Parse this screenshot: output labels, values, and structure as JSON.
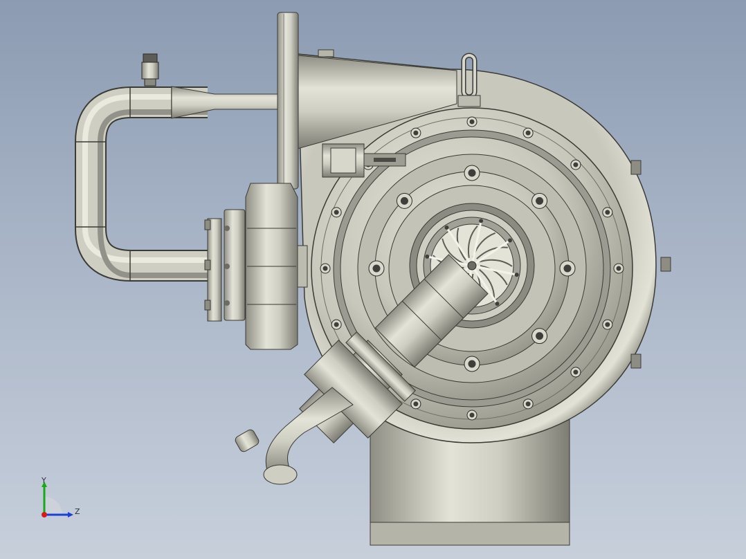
{
  "viewport": {
    "background_top": "#8c9bb2",
    "background_bottom": "#c7cfdb"
  },
  "model": {
    "body_color": "#c9c8bc",
    "shadow_color": "#8e8d83",
    "edge_color": "#3a3a36",
    "impeller_blades": 13
  },
  "triad": {
    "y_label": "Y",
    "z_label": "Z",
    "y_color": "#1aa81a",
    "z_color": "#1c3fd6",
    "x_color": "#d21d1d"
  }
}
